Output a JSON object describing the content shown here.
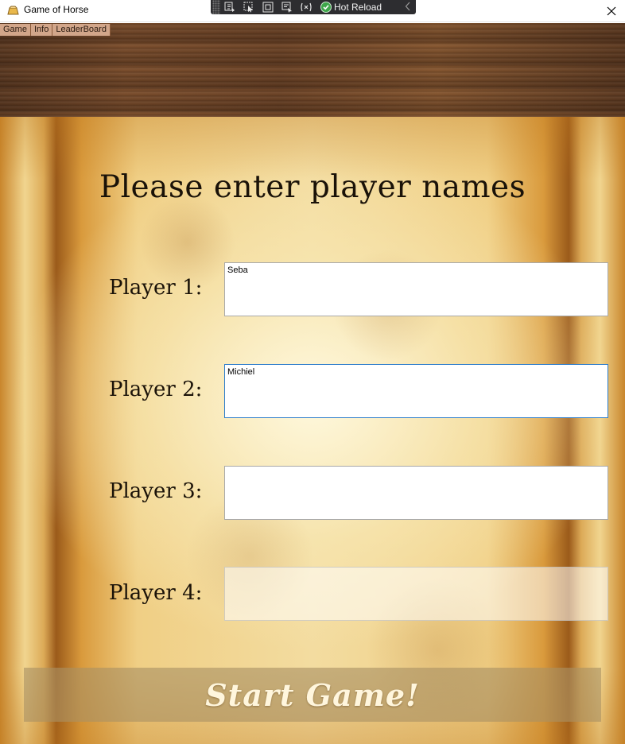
{
  "window": {
    "title": "Game of Horse"
  },
  "debug_toolbar": {
    "hot_reload_label": "Hot Reload"
  },
  "menu": {
    "items": [
      "Game",
      "Info",
      "LeaderBoard"
    ]
  },
  "form": {
    "heading": "Please enter player names",
    "players": [
      {
        "label": "Player 1:",
        "value": "Seba"
      },
      {
        "label": "Player 2:",
        "value": "Michiel"
      },
      {
        "label": "Player 3:",
        "value": ""
      },
      {
        "label": "Player 4:",
        "value": ""
      }
    ],
    "start_label": "Start Game!"
  },
  "icons": {
    "app": "horse-game-icon",
    "close": "close-icon",
    "hot_reload": "check-circle-icon"
  },
  "colors": {
    "focus_border": "#2b7ccb",
    "hot_reload_ok": "#3ea64a"
  }
}
